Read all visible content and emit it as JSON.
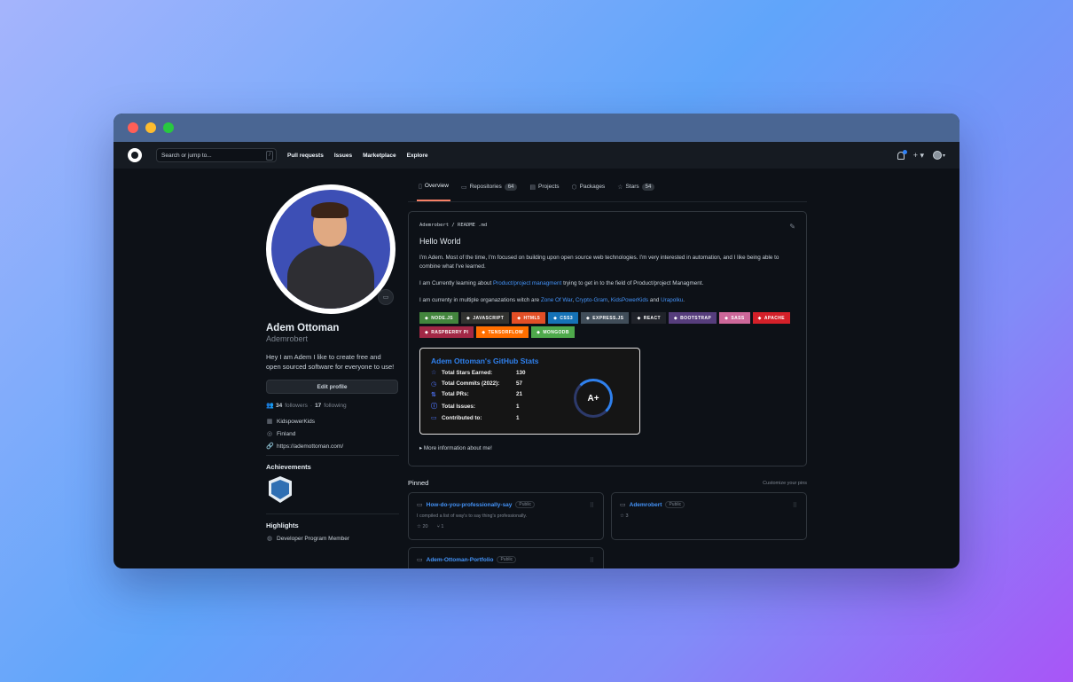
{
  "header": {
    "search_placeholder": "Search or jump to...",
    "search_shortcut": "/",
    "nav": [
      "Pull requests",
      "Issues",
      "Marketplace",
      "Explore"
    ],
    "plus_label": "+ ▾",
    "avatar_caret": "▾"
  },
  "profile": {
    "name": "Adem Ottoman",
    "login": "Ademrobert",
    "bio": "Hey I am Adem I like to create free and open sourced software for everyone to use!",
    "edit_label": "Edit profile",
    "followers_count": "34",
    "followers_label": "followers",
    "sep": "·",
    "following_count": "17",
    "following_label": "following",
    "company": "KidspowerKids",
    "location": "Finland",
    "website": "https://ademottoman.com/",
    "achievements_title": "Achievements",
    "highlights_title": "Highlights",
    "highlight_item": "Developer Program Member"
  },
  "tabs": [
    {
      "label": "Overview",
      "count": ""
    },
    {
      "label": "Repositories",
      "count": "64"
    },
    {
      "label": "Projects",
      "count": ""
    },
    {
      "label": "Packages",
      "count": ""
    },
    {
      "label": "Stars",
      "count": "54"
    }
  ],
  "readme": {
    "path": "Ademrobert / README .md",
    "title": "Hello World",
    "p1": "I'm Adem. Most of the time, I'm focused on building upon open source web technologies. I'm very interested in automation, and I like being able to combine what I've learned.",
    "p2_a": "I am Currently learning about",
    "p2_link": "Product/project managment",
    "p2_b": "trying to get in to the field of Product/project Managment.",
    "p3_a": "I am currenty in multiple organazations witch are",
    "p3_l1": "Zone Of War",
    "p3_l2": "Crypto-Gram",
    "p3_l3": "KidsPowerKids",
    "p3_and": "and",
    "p3_l4": "Urapolku",
    "tags": [
      {
        "label": "NODE.JS",
        "color": "#43853d"
      },
      {
        "label": "JAVASCRIPT",
        "color": "#323330"
      },
      {
        "label": "HTML5",
        "color": "#e34f26"
      },
      {
        "label": "CSS3",
        "color": "#1572b6"
      },
      {
        "label": "EXPRESS.JS",
        "color": "#404d59"
      },
      {
        "label": "REACT",
        "color": "#20232a"
      },
      {
        "label": "BOOTSTRAP",
        "color": "#563d7c"
      },
      {
        "label": "SASS",
        "color": "#cd6799"
      },
      {
        "label": "APACHE",
        "color": "#d42029"
      },
      {
        "label": "RASPBERRY PI",
        "color": "#a22846"
      },
      {
        "label": "TENSORFLOW",
        "color": "#ff6f00"
      },
      {
        "label": "MONGODB",
        "color": "#4ea94b"
      }
    ],
    "more": "More information about me!"
  },
  "stats": {
    "title": "Adem Ottoman's GitHub Stats",
    "rows": [
      {
        "label": "Total Stars Earned:",
        "value": "130"
      },
      {
        "label": "Total Commits (2022):",
        "value": "57"
      },
      {
        "label": "Total PRs:",
        "value": "21"
      },
      {
        "label": "Total Issues:",
        "value": "1"
      },
      {
        "label": "Contributed to:",
        "value": "1"
      }
    ],
    "grade": "A+"
  },
  "pinned": {
    "title": "Pinned",
    "customize": "Customize your pins",
    "repos": [
      {
        "name": "How-do-you-professionally-say",
        "visibility": "Public",
        "desc": "I compiled a list of way's to say thing's professionally.",
        "stars": "20",
        "forks": "1"
      },
      {
        "name": "Ademrobert",
        "visibility": "Public",
        "desc": "",
        "stars": "3",
        "forks": ""
      },
      {
        "name": "Adem-Ottoman-Portfolio",
        "visibility": "Public",
        "desc": "",
        "stars": "",
        "forks": ""
      }
    ]
  }
}
